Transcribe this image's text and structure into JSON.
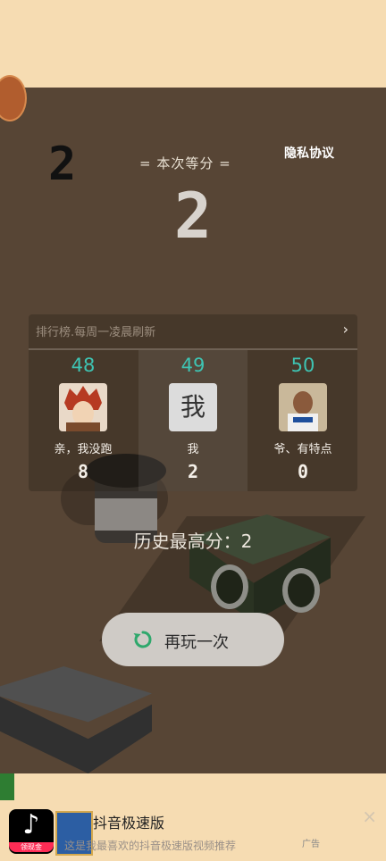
{
  "header": {
    "best_of_round_digit": "2",
    "this_round_label": "= 本次等分 =",
    "privacy_link": "隐私协议",
    "current_score": "2"
  },
  "leaderboard": {
    "title": "排行榜.每周一凌晨刷新",
    "arrow": "›",
    "entries": [
      {
        "rank": "48",
        "name": "亲，我没跑",
        "score": "8"
      },
      {
        "rank": "49",
        "name": "我",
        "score": "2",
        "avatar_text": "我"
      },
      {
        "rank": "50",
        "name": "爷、有特点",
        "score": "0"
      }
    ]
  },
  "best_score_text": "历史最高分：2",
  "replay": {
    "label": "再玩一次"
  },
  "ad": {
    "app_badge": "领现金",
    "title": "抖音极速版",
    "description": "这是我最喜欢的抖音极速版视频推荐",
    "ad_tag": "广告",
    "close": "×"
  },
  "colors": {
    "accent_teal": "#3ec4b3",
    "game_bg": "#574535",
    "top_bg": "#f6dcb2"
  }
}
